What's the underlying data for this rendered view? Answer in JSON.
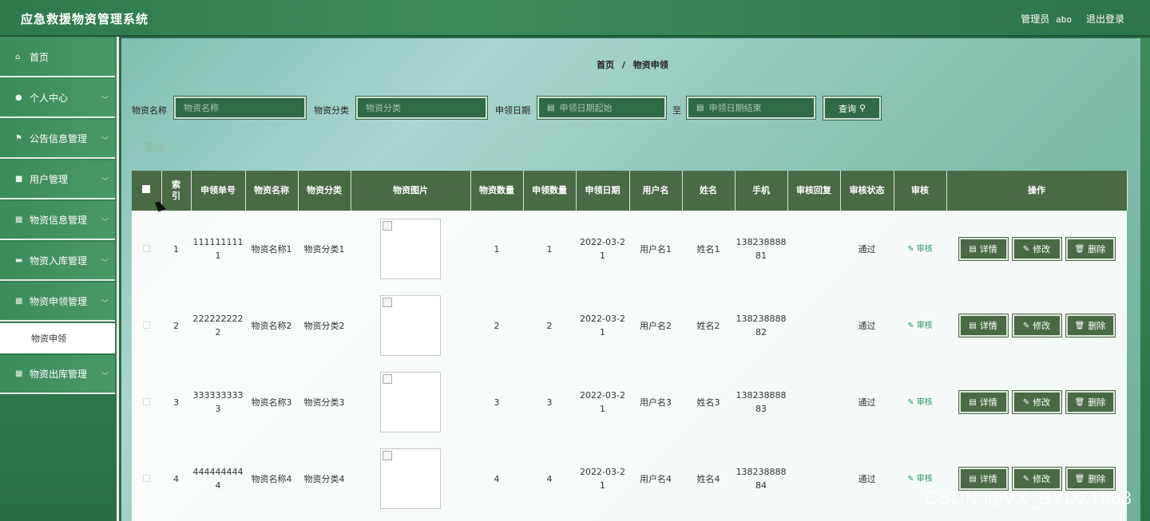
{
  "header": {
    "title": "应急救援物资管理系统",
    "admin_label": "管理员",
    "admin_name": "abo",
    "logout": "退出登录"
  },
  "sidebar": {
    "items": [
      {
        "label": "首页",
        "icon": "home-icon"
      },
      {
        "label": "个人中心",
        "icon": "user-icon"
      },
      {
        "label": "公告信息管理",
        "icon": "flag-icon"
      },
      {
        "label": "用户管理",
        "icon": "square-icon"
      },
      {
        "label": "物资信息管理",
        "icon": "grid-icon"
      },
      {
        "label": "物资入库管理",
        "icon": "chat-icon"
      },
      {
        "label": "物资申领管理",
        "icon": "grid-icon"
      },
      {
        "label": "物资出库管理",
        "icon": "grid-icon"
      }
    ],
    "sub_item": "物资申领"
  },
  "breadcrumb": {
    "home": "首页",
    "separator": "/",
    "current": "物资申领"
  },
  "filters": {
    "name_label": "物资名称",
    "name_placeholder": "物资名称",
    "category_label": "物资分类",
    "category_placeholder": "物资分类",
    "date_label": "申领日期",
    "date_start_placeholder": "申领日期起始",
    "date_to": "至",
    "date_end_placeholder": "申领日期结束",
    "search_button": "查询"
  },
  "actions": {
    "bulk_delete": "删除"
  },
  "table": {
    "headers": [
      "索引",
      "申领单号",
      "物资名称",
      "物资分类",
      "物资图片",
      "物资数量",
      "申领数量",
      "申领日期",
      "用户名",
      "姓名",
      "手机",
      "审核回复",
      "审核状态",
      "审核",
      "操作"
    ],
    "audit_link": "审核",
    "btn_detail": "详情",
    "btn_edit": "修改",
    "btn_delete": "删除",
    "rows": [
      {
        "index": "1",
        "order_no": "111111111\n1",
        "name": "物资名称1",
        "category": "物资分类1",
        "qty": "1",
        "apply_qty": "1",
        "date": "2022-03-2\n1",
        "username": "用户名1",
        "realname": "姓名1",
        "phone": "138238888\n81",
        "reply": "",
        "status": "通过"
      },
      {
        "index": "2",
        "order_no": "222222222\n2",
        "name": "物资名称2",
        "category": "物资分类2",
        "qty": "2",
        "apply_qty": "2",
        "date": "2022-03-2\n1",
        "username": "用户名2",
        "realname": "姓名2",
        "phone": "138238888\n82",
        "reply": "",
        "status": "通过"
      },
      {
        "index": "3",
        "order_no": "333333333\n3",
        "name": "物资名称3",
        "category": "物资分类3",
        "qty": "3",
        "apply_qty": "3",
        "date": "2022-03-2\n1",
        "username": "用户名3",
        "realname": "姓名3",
        "phone": "138238888\n83",
        "reply": "",
        "status": "通过"
      },
      {
        "index": "4",
        "order_no": "444444444\n4",
        "name": "物资名称4",
        "category": "物资分类4",
        "qty": "4",
        "apply_qty": "4",
        "date": "2022-03-2\n1",
        "username": "用户名4",
        "realname": "姓名4",
        "phone": "138238888\n84",
        "reply": "",
        "status": "通过"
      }
    ]
  },
  "watermark": "CSDN @VX_BYDZ1988",
  "colors": {
    "header_green": "#2f7a4c",
    "table_head": "#496a45",
    "link_green": "#2f8f5e"
  }
}
